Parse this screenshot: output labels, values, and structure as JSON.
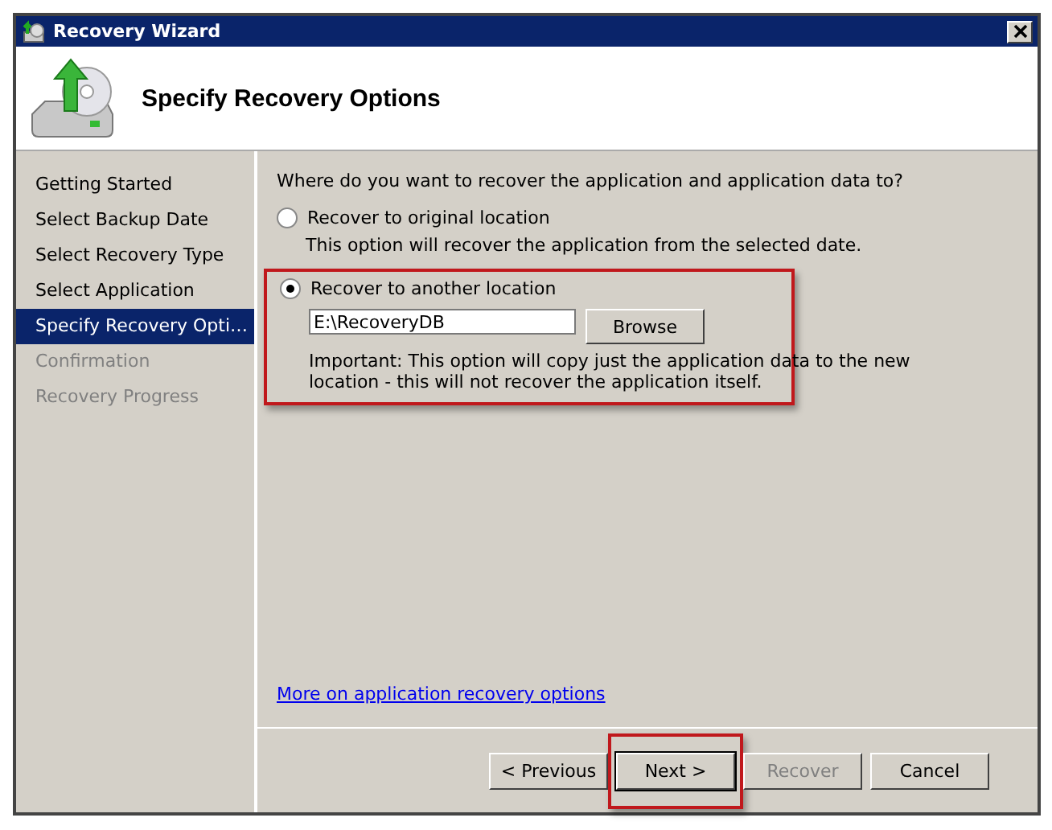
{
  "window": {
    "title": "Recovery Wizard"
  },
  "header": {
    "title": "Specify Recovery Options"
  },
  "sidebar": {
    "items": [
      {
        "label": "Getting Started",
        "selected": false,
        "disabled": false
      },
      {
        "label": "Select Backup Date",
        "selected": false,
        "disabled": false
      },
      {
        "label": "Select Recovery Type",
        "selected": false,
        "disabled": false
      },
      {
        "label": "Select Application",
        "selected": false,
        "disabled": false
      },
      {
        "label": "Specify Recovery Opti…",
        "selected": true,
        "disabled": false
      },
      {
        "label": "Confirmation",
        "selected": false,
        "disabled": true
      },
      {
        "label": "Recovery Progress",
        "selected": false,
        "disabled": true
      }
    ]
  },
  "content": {
    "question": "Where do you want to recover the application and application data to?",
    "options": [
      {
        "label": "Recover to original location",
        "selected": false,
        "highlighted": false,
        "description": "This option will recover the application from the selected date."
      },
      {
        "label": "Recover to another location",
        "selected": true,
        "highlighted": true,
        "path_value": "E:\\RecoveryDB",
        "browse_button": "Browse",
        "description": "Important: This option will copy just the application data to the new location - this will not recover the application itself."
      }
    ],
    "link": "More on application recovery options"
  },
  "buttons": [
    {
      "label": "< Previous",
      "disabled": false,
      "default": false,
      "highlighted": false
    },
    {
      "label": "Next >",
      "disabled": false,
      "default": true,
      "highlighted": true
    },
    {
      "label": "Recover",
      "disabled": true,
      "default": false,
      "highlighted": false
    },
    {
      "label": "Cancel",
      "disabled": false,
      "default": false,
      "highlighted": false
    }
  ]
}
